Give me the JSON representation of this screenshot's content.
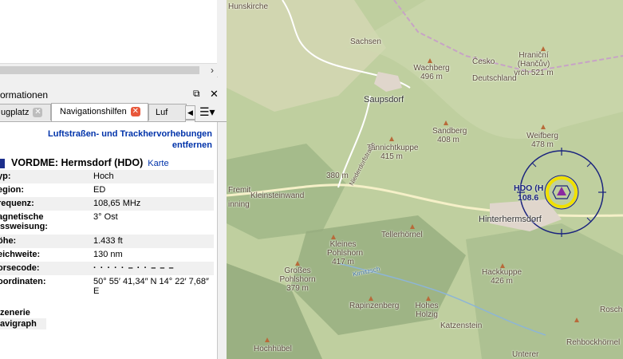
{
  "dock": {
    "title": "ormationen",
    "float_icon": "⧉",
    "close_icon": "✕"
  },
  "tabs": [
    {
      "label": "ugplatz",
      "active": false
    },
    {
      "label": "Navigationshilfen",
      "active": true
    },
    {
      "label": "Luf",
      "active": false
    }
  ],
  "tab_close": "✕",
  "tab_arrows": {
    "left": "◀",
    "right": "▶"
  },
  "tab_menu_icon": "☰▾",
  "scroll_arrow": "›",
  "remove_link": "Luftstraßen- und Trackhervorhebungen entfernen",
  "vor": {
    "title": "VORDME: Hermsdorf (HDO)",
    "karte_link": "Karte"
  },
  "properties": [
    {
      "key": "yp:",
      "value": "Hoch"
    },
    {
      "key": "egion:",
      "value": "ED"
    },
    {
      "key": "requenz:",
      "value": "108,65 MHz"
    },
    {
      "key": "agnetische issweisung:",
      "value": "3° Ost"
    },
    {
      "key": "öhe:",
      "value": "1.433 ft"
    },
    {
      "key": "eichweite:",
      "value": "130 nm"
    },
    {
      "key": "orsecode:",
      "value": "· · · · ·  – · ·  – – –"
    },
    {
      "key": "oordinaten:",
      "value": "50° 55′ 41,34″ N 14° 22′ 7,68″ E"
    }
  ],
  "extra": {
    "scenery": "zenerie",
    "navigraph": "avigraph"
  },
  "map_labels": [
    {
      "text": "Hunskirche",
      "cls": ""
    },
    {
      "text": "Sachsen",
      "cls": ""
    },
    {
      "text": "Česko",
      "cls": ""
    },
    {
      "text": "Deutschland",
      "cls": ""
    },
    {
      "text": "Hraniční (Hančův) vrch 521 m",
      "cls": ""
    },
    {
      "text": "Wachberg 496 m",
      "cls": ""
    },
    {
      "text": "Saupsdorf",
      "cls": "town"
    },
    {
      "text": "Sandberg 408 m",
      "cls": ""
    },
    {
      "text": "Weifberg 478 m",
      "cls": ""
    },
    {
      "text": "Tannichtkuppe 415 m",
      "cls": ""
    },
    {
      "text": "380 m",
      "cls": ""
    },
    {
      "text": "Niederdorfstraße",
      "cls": ""
    },
    {
      "text": "Kleinsteinwand",
      "cls": ""
    },
    {
      "text": "Fremit",
      "cls": ""
    },
    {
      "text": "inning",
      "cls": ""
    },
    {
      "text": "Hinterhermsdorf",
      "cls": "town"
    },
    {
      "text": "Tellerhörnel",
      "cls": ""
    },
    {
      "text": "Kleines Pohlshorn 417 m",
      "cls": ""
    },
    {
      "text": "Großes Pohlshorn 379 m",
      "cls": ""
    },
    {
      "text": "Kirnitzsch",
      "cls": ""
    },
    {
      "text": "Hackkuppe 426 m",
      "cls": ""
    },
    {
      "text": "Rapinzenberg",
      "cls": ""
    },
    {
      "text": "Hohes Holzig",
      "cls": ""
    },
    {
      "text": "Katzenstein",
      "cls": ""
    },
    {
      "text": "Rosch",
      "cls": ""
    },
    {
      "text": "Rehbockhörnel",
      "cls": ""
    },
    {
      "text": "Hochhübel",
      "cls": ""
    },
    {
      "text": "Unterer",
      "cls": ""
    }
  ],
  "vor_map": {
    "label": "HDO (H",
    "freq": "108.6"
  }
}
